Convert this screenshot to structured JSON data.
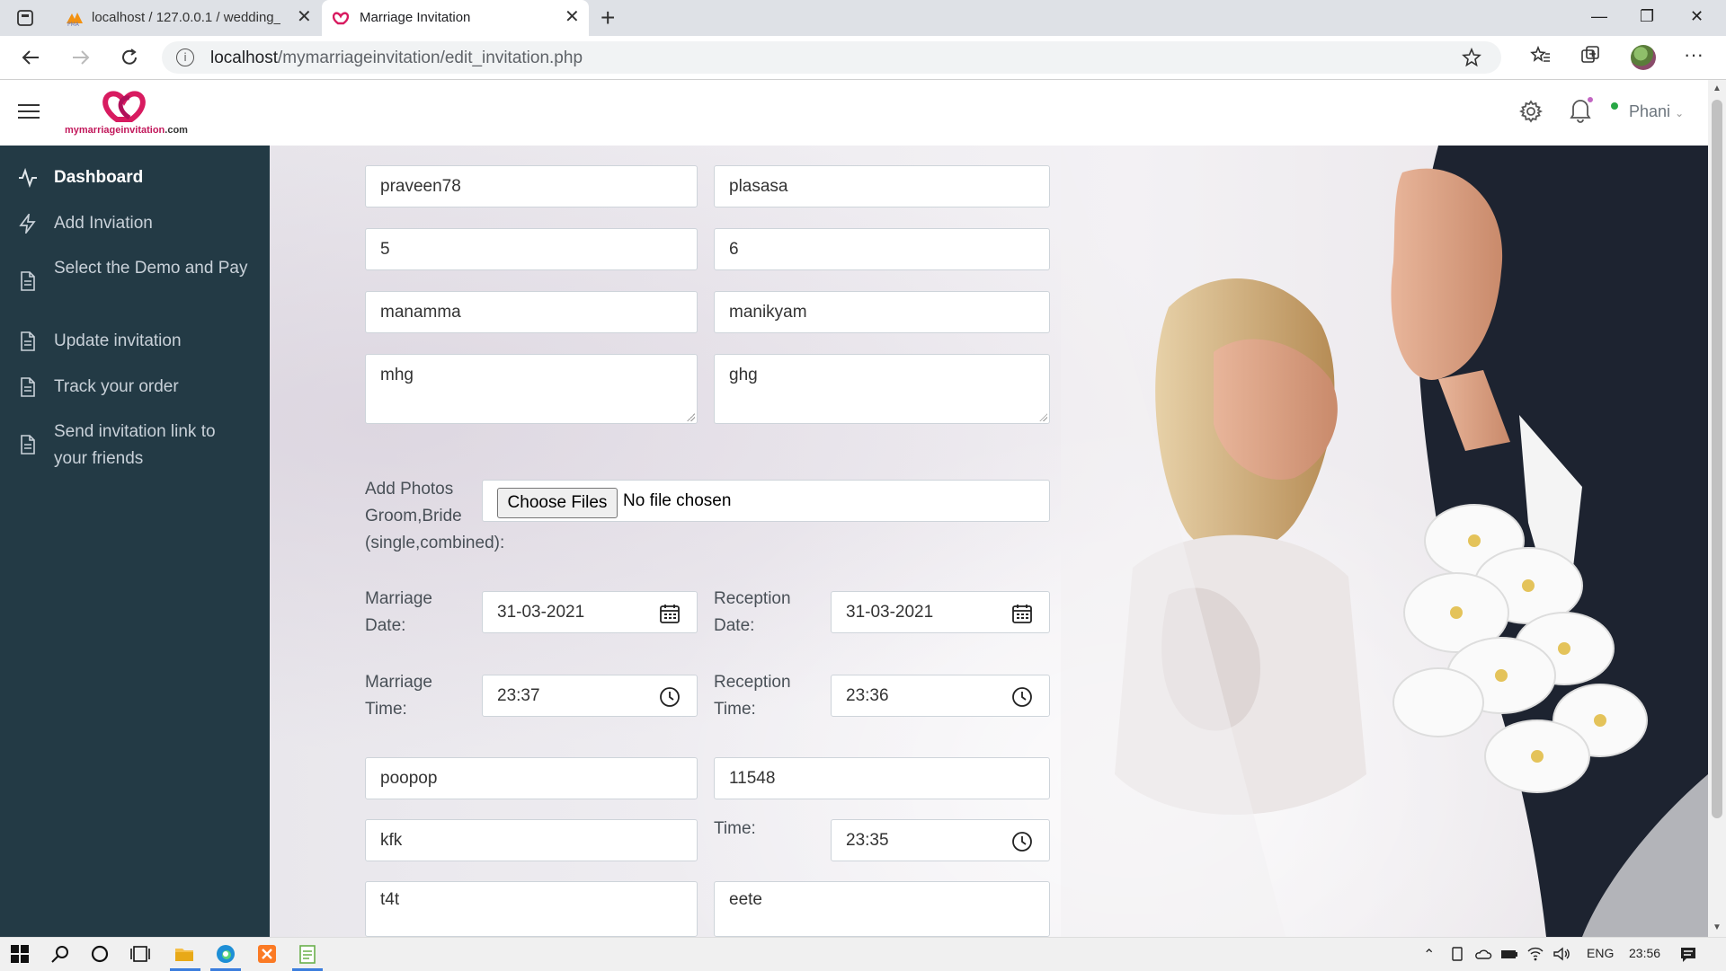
{
  "browser": {
    "tabs": [
      {
        "title": "localhost / 127.0.0.1 / wedding_i",
        "favicon": "pma-icon"
      },
      {
        "title": "Marriage Invitation",
        "favicon": "heart-logo-icon",
        "active": true
      }
    ],
    "url_host": "localhost",
    "url_path": "/mymarriageinvitation/edit_invitation.php"
  },
  "header": {
    "logo_text": "mymarriageinvitation",
    "logo_suffix": ".com",
    "user_name": "Phani",
    "accent": "#d81b60"
  },
  "sidebar": {
    "background": "#233a45",
    "items": [
      {
        "label": "Dashboard",
        "icon": "activity-icon",
        "active": true
      },
      {
        "label": "Add Inviation",
        "icon": "bolt-icon"
      },
      {
        "label": "Select the Demo and Pay",
        "icon": "document-icon"
      },
      {
        "label": "Update invitation",
        "icon": "document-icon"
      },
      {
        "label": "Track your order",
        "icon": "document-icon"
      },
      {
        "label": "Send invitation link to your friends",
        "icon": "document-icon"
      }
    ]
  },
  "form": {
    "row1": {
      "left": "praveen78",
      "right": "plasasa"
    },
    "row2": {
      "left": "5",
      "right": "6"
    },
    "row3": {
      "left": "manamma",
      "right": "manikyam"
    },
    "row4": {
      "left": "mhg",
      "right": "ghg"
    },
    "photos_label": "Add Photos Groom,Bride (single,combined):",
    "choose_files": "Choose Files",
    "no_file": "No file chosen",
    "marriage_date_label": "Marriage Date:",
    "marriage_date": "31-03-2021",
    "reception_date_label": "Reception Date:",
    "reception_date": "31-03-2021",
    "marriage_time_label": "Marriage Time:",
    "marriage_time": "23:37",
    "reception_time_label": "Reception Time:",
    "reception_time": "23:36",
    "row7": {
      "left": "poopop",
      "right": "11548"
    },
    "row8_left": "kfk",
    "time_label": "Time:",
    "time_value": "23:35",
    "row9": {
      "left": "t4t",
      "right": "eete"
    }
  },
  "taskbar": {
    "language": "ENG",
    "clock": "23:56"
  }
}
